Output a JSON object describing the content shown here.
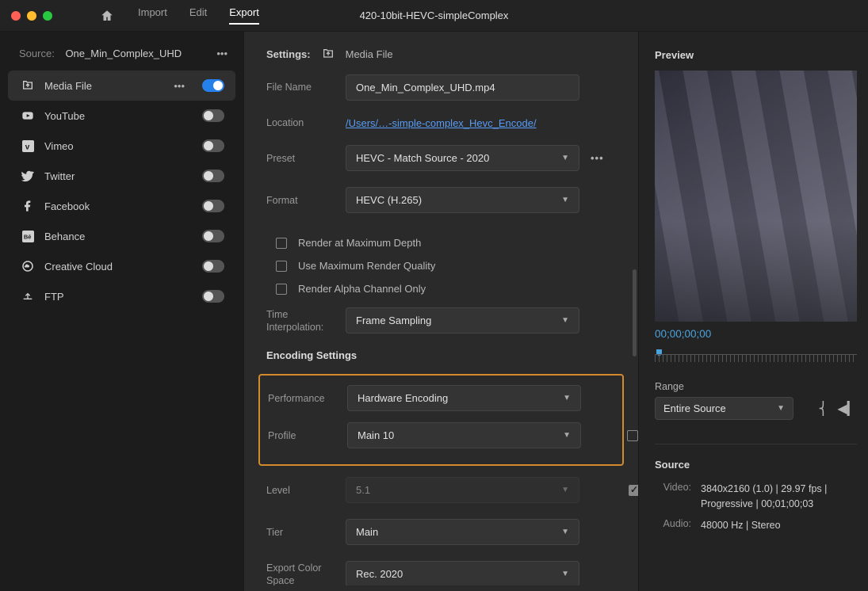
{
  "window_title": "420-10bit-HEVC-simpleComplex",
  "tabs": {
    "t0": "Import",
    "t1": "Edit",
    "t2": "Export"
  },
  "source_label": "Source:",
  "source_name": "One_Min_Complex_UHD",
  "destinations": [
    {
      "label": "Media File",
      "active": true,
      "on": true,
      "icon": "export"
    },
    {
      "label": "YouTube",
      "active": false,
      "on": false,
      "icon": "youtube"
    },
    {
      "label": "Vimeo",
      "active": false,
      "on": false,
      "icon": "vimeo"
    },
    {
      "label": "Twitter",
      "active": false,
      "on": false,
      "icon": "twitter"
    },
    {
      "label": "Facebook",
      "active": false,
      "on": false,
      "icon": "facebook"
    },
    {
      "label": "Behance",
      "active": false,
      "on": false,
      "icon": "behance"
    },
    {
      "label": "Creative Cloud",
      "active": false,
      "on": false,
      "icon": "creativecloud"
    },
    {
      "label": "FTP",
      "active": false,
      "on": false,
      "icon": "ftp"
    }
  ],
  "settings": {
    "header_label": "Settings:",
    "header_mf": "Media File",
    "file_name_label": "File Name",
    "file_name": "One_Min_Complex_UHD.mp4",
    "location_label": "Location",
    "location": "/Users/…-simple-complex_Hevc_Encode/",
    "preset_label": "Preset",
    "preset": "HEVC - Match Source - 2020",
    "format_label": "Format",
    "format": "HEVC (H.265)",
    "c0": "Render at Maximum Depth",
    "c1": "Use Maximum Render Quality",
    "c2": "Render Alpha Channel Only",
    "time_interp_label": "Time Interpolation:",
    "time_interp": "Frame Sampling",
    "encoding_title": "Encoding Settings",
    "performance_label": "Performance",
    "performance": "Hardware Encoding",
    "profile_label": "Profile",
    "profile": "Main 10",
    "level_label": "Level",
    "level": "5.1",
    "tier_label": "Tier",
    "tier": "Main",
    "colorspace_label": "Export Color Space",
    "colorspace": "Rec. 2020"
  },
  "preview": {
    "title": "Preview",
    "timecode": "00;00;00;00",
    "range_label": "Range",
    "range": "Entire Source",
    "source_title": "Source",
    "video_label": "Video:",
    "video_val": "3840x2160 (1.0) | 29.97 fps | Progressive | 00;01;00;03",
    "audio_label": "Audio:",
    "audio_val": "48000 Hz | Stereo"
  }
}
